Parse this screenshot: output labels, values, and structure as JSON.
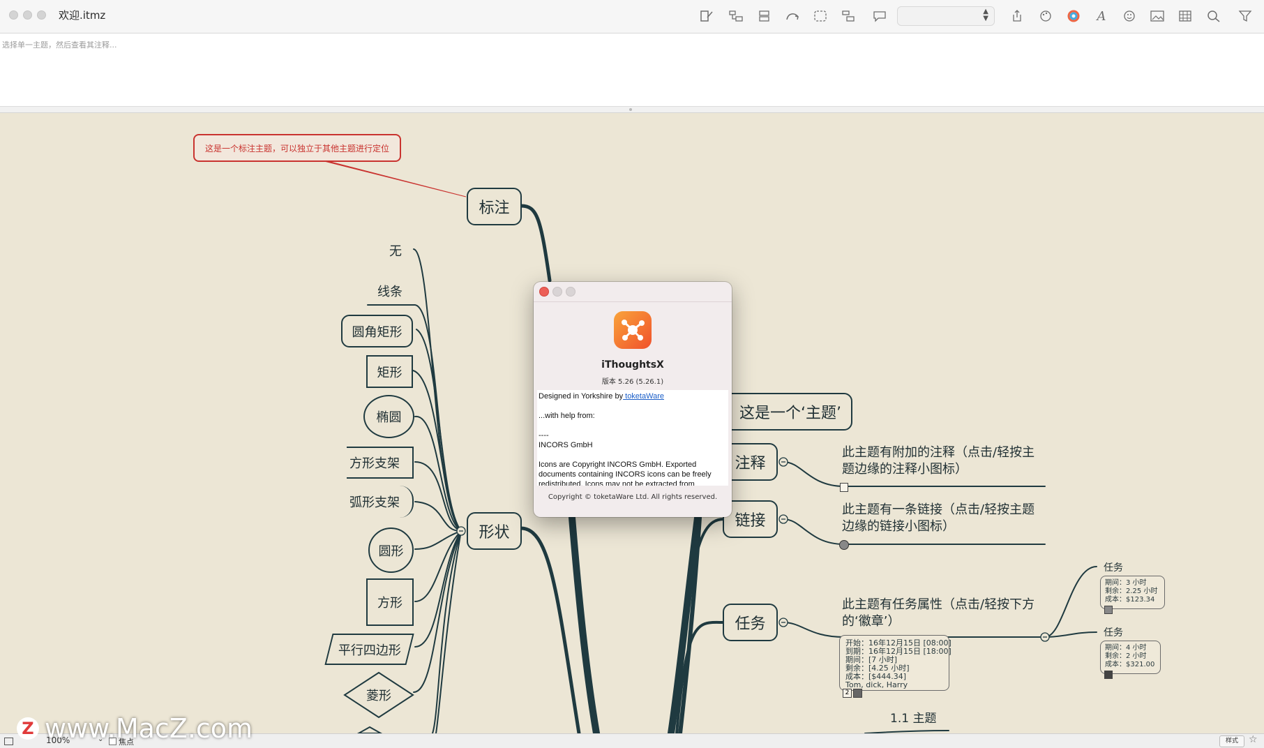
{
  "window": {
    "title": "欢迎.itmz"
  },
  "toolbar": {
    "icons": [
      "new-topic-icon",
      "child-topic-icon",
      "sibling-topic-icon",
      "relationship-icon",
      "boundary-icon",
      "layout-icon",
      "callout-icon",
      "share-icon",
      "style-palette-icon",
      "color-wheel-icon",
      "font-icon",
      "emoji-icon",
      "image-icon",
      "table-icon",
      "search-icon",
      "filter-icon"
    ],
    "stepper_value": ""
  },
  "notes": {
    "placeholder": "选择单一主题，然后查看其注释..."
  },
  "canvas": {
    "callout_text": "这是一个标注主题，可以独立于其他主题进行定位",
    "topics": {
      "callout": "标注",
      "shape": "形状",
      "main_topic": "这是一个‘主题’",
      "note": "注释",
      "link": "链接",
      "task": "任务",
      "sub_topic": "1.1 主题"
    },
    "shape_options": {
      "none": "无",
      "line": "线条",
      "rounded_rect": "圆角矩形",
      "rect": "矩形",
      "ellipse": "椭圆",
      "square_bracket": "方形支架",
      "arc_bracket": "弧形支架",
      "circle": "圆形",
      "square": "方形",
      "parallelogram": "平行四边形",
      "diamond": "菱形"
    },
    "note_desc": "此主题有附加的注释（点击/轻按主题边缘的注释小图标）",
    "link_desc": "此主题有一条链接（点击/轻按主题边缘的链接小图标）",
    "task_desc": "此主题有任务属性（点击/轻按下方的‘徽章’）",
    "task_card": {
      "lines": [
        "开始：16年12月15日 [08:00]",
        "到期：16年12月15日 [18:00]",
        "期间：[7 小时]",
        "剩余：[4.25 小时]",
        "成本：[$444.34]",
        "Tom, dick, Harry"
      ],
      "badge": "2"
    },
    "subtasks": [
      {
        "title": "任务",
        "lines": [
          "期间：3 小时",
          "剩余：2.25 小时",
          "成本：$123.34"
        ]
      },
      {
        "title": "任务",
        "lines": [
          "期间：4 小时",
          "剩余：2 小时",
          "成本：$321.00"
        ]
      }
    ]
  },
  "about_dialog": {
    "app_name": "iThoughtsX",
    "version": "版本 5.26 (5.26.1)",
    "credits": {
      "designed": "Designed in Yorkshire by",
      "link": " toketaWare",
      "help": "...with help from:",
      "dashes": "----",
      "company": "INCORS GmbH",
      "icons": "Icons are Copyright INCORS GmbH. Exported documents containing INCORS icons can be freely redistributed. Icons may not be extracted from"
    },
    "copyright": "Copyright © toketaWare Ltd. All rights reserved."
  },
  "statusbar": {
    "zoom": "100%",
    "focus_label": "焦点",
    "style_button": "样式"
  },
  "watermark": {
    "logo": "Z",
    "text": "www.MacZ.com"
  }
}
